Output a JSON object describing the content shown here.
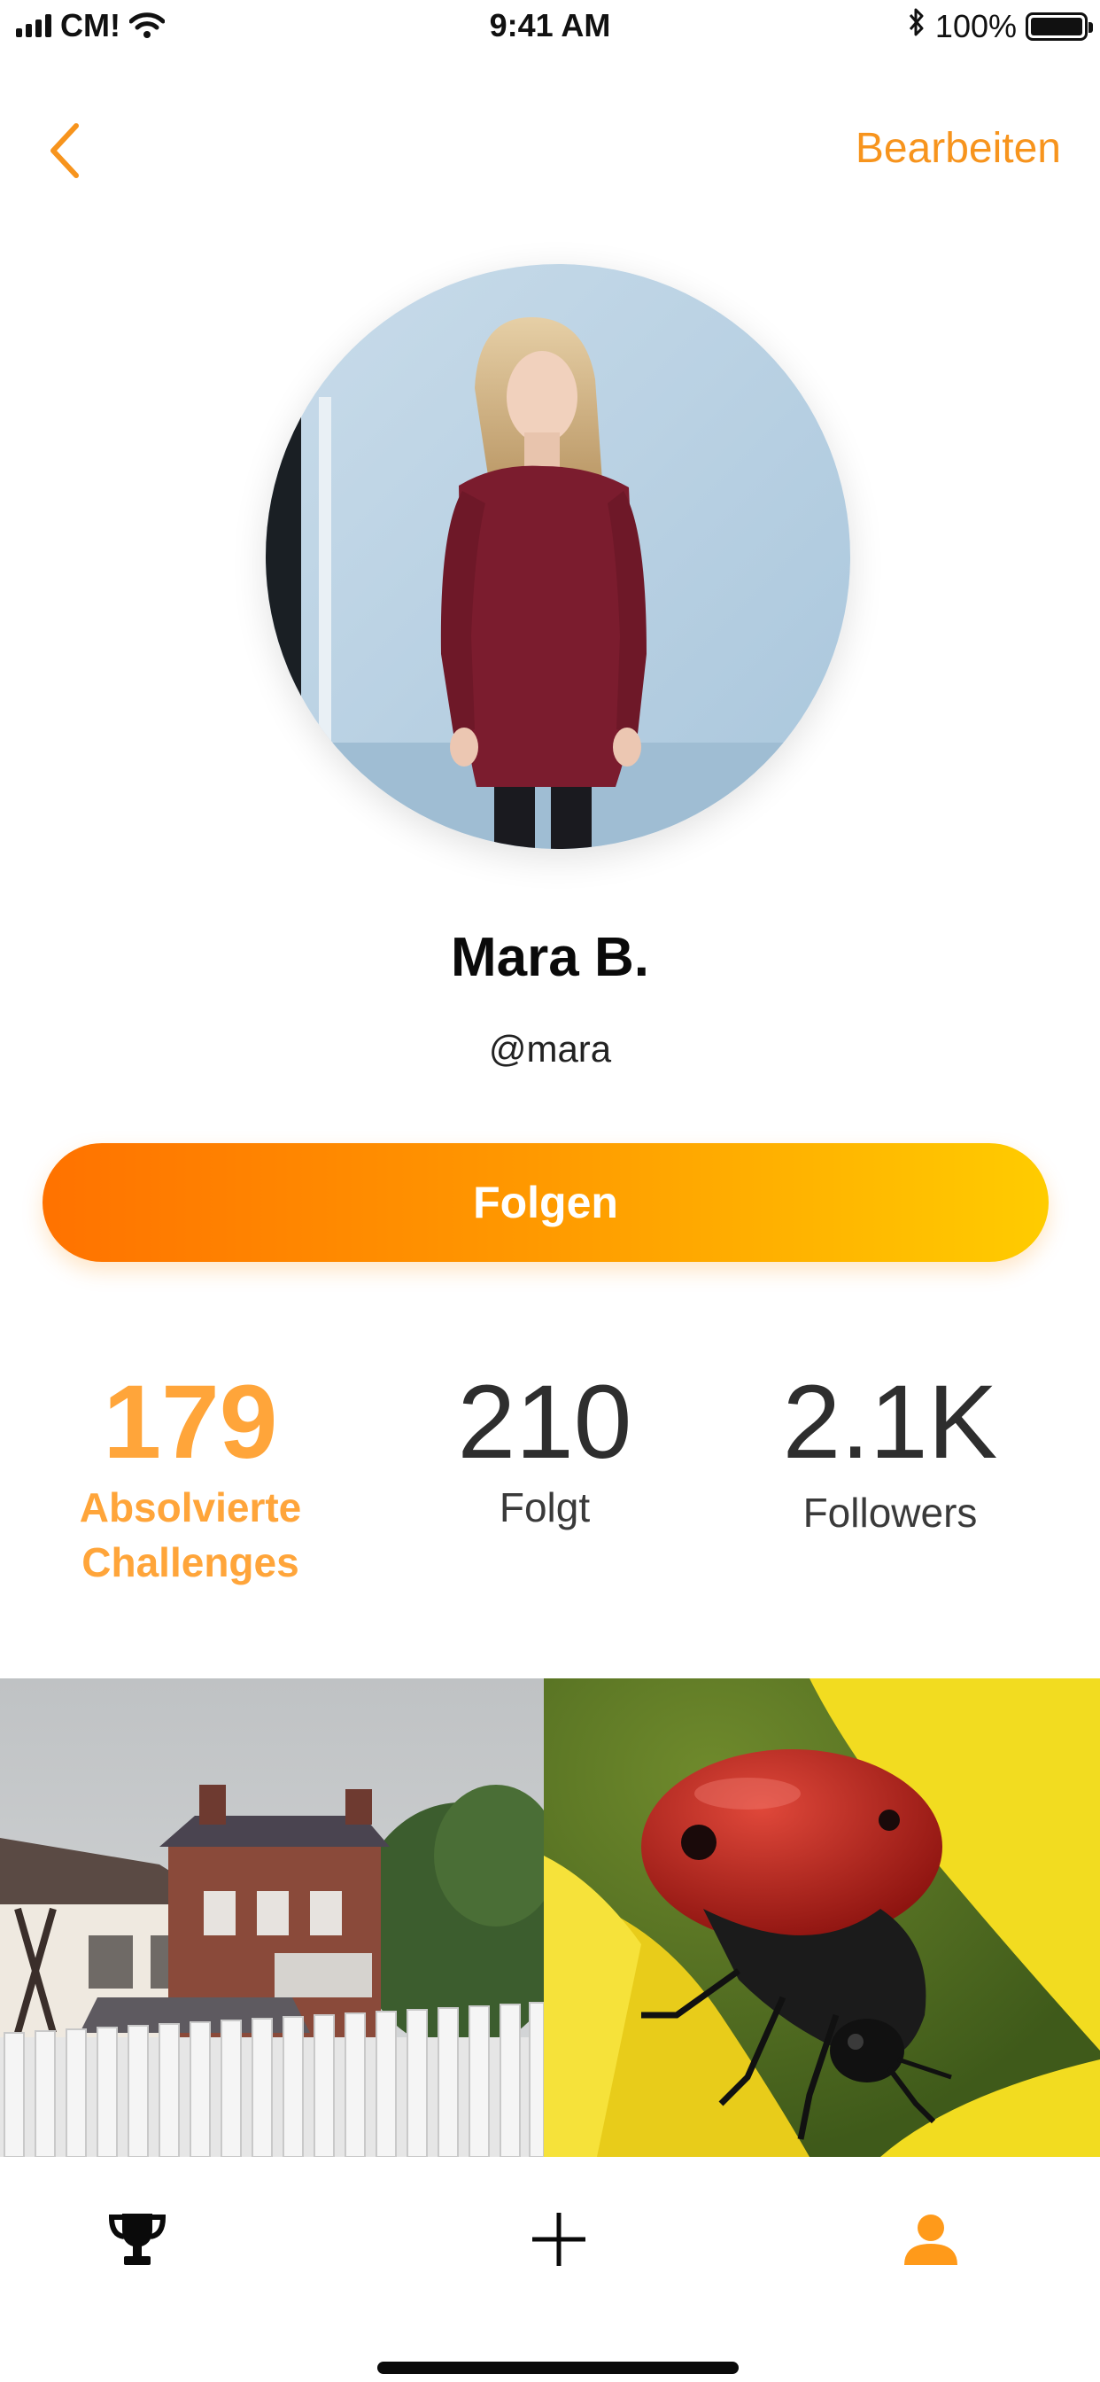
{
  "status_bar": {
    "carrier": "CM!",
    "time": "9:41 AM",
    "battery": "100%"
  },
  "nav": {
    "edit_label": "Bearbeiten"
  },
  "profile": {
    "name": "Mara B.",
    "handle": "@mara"
  },
  "follow_button": {
    "label": "Folgen"
  },
  "stats": [
    {
      "value": "179",
      "label_line1": "Absolvierte",
      "label_line2": "Challenges"
    },
    {
      "value": "210",
      "label": "Folgt"
    },
    {
      "value": "2.1K",
      "label": "Followers"
    }
  ],
  "tabs": [
    {
      "icon": "trophy-icon",
      "active": false
    },
    {
      "icon": "plus-icon",
      "active": false
    },
    {
      "icon": "profile-icon",
      "active": true
    }
  ],
  "colors": {
    "accent": "#f7941d",
    "gradient_start": "#ff7200",
    "gradient_end": "#ffcc00",
    "stat_highlight": "#ffa53a"
  }
}
